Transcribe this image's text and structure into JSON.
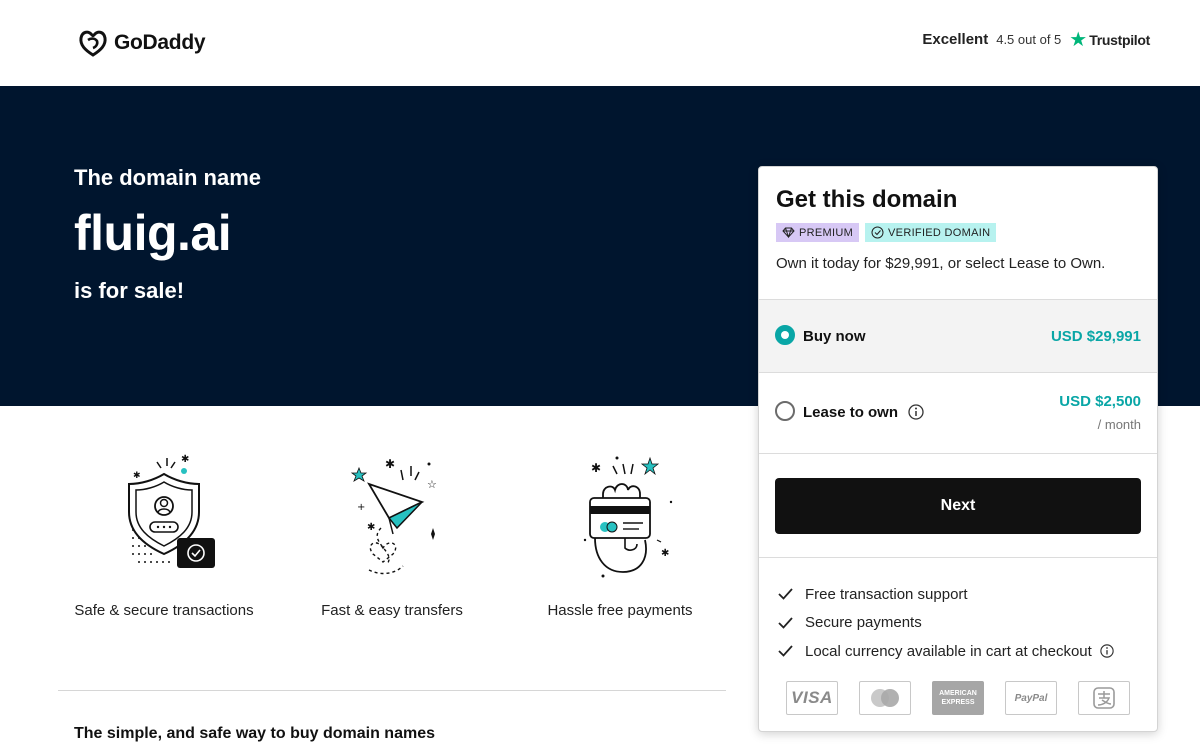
{
  "header": {
    "logo_text": "GoDaddy",
    "trust_rating_word": "Excellent",
    "trust_score": "4.5 out of 5",
    "trust_brand": "Trustpilot"
  },
  "hero": {
    "pretitle": "The domain name",
    "domain": "fluig.ai",
    "posttitle": "is for sale!"
  },
  "features": [
    {
      "label": "Safe & secure transactions",
      "icon": "shield-user-icon"
    },
    {
      "label": "Fast & easy transfers",
      "icon": "paper-plane-icon"
    },
    {
      "label": "Hassle free payments",
      "icon": "hand-card-icon"
    }
  ],
  "bottom_heading": "The simple, and safe way to buy domain names",
  "card": {
    "title": "Get this domain",
    "badges": [
      "PREMIUM",
      "VERIFIED DOMAIN"
    ],
    "subtitle": "Own it today for $29,991, or select Lease to Own.",
    "options": [
      {
        "label": "Buy now",
        "price": "USD $29,991",
        "unit": "",
        "selected": true
      },
      {
        "label": "Lease to own",
        "price": "USD $2,500",
        "unit": "/ month",
        "selected": false
      }
    ],
    "next_label": "Next",
    "benefits": [
      "Free transaction support",
      "Secure payments",
      "Local currency available in cart at checkout"
    ],
    "payment_methods": [
      "VISA",
      "Mastercard",
      "AMERICAN EXPRESS",
      "PayPal",
      "Alipay"
    ]
  },
  "colors": {
    "hero_bg": "#00152e",
    "accent_teal": "#09a6a6",
    "trustpilot_green": "#00b67a",
    "premium_badge": "#d7c8f5",
    "verified_badge": "#b7f2ef",
    "button_bg": "#111111"
  }
}
